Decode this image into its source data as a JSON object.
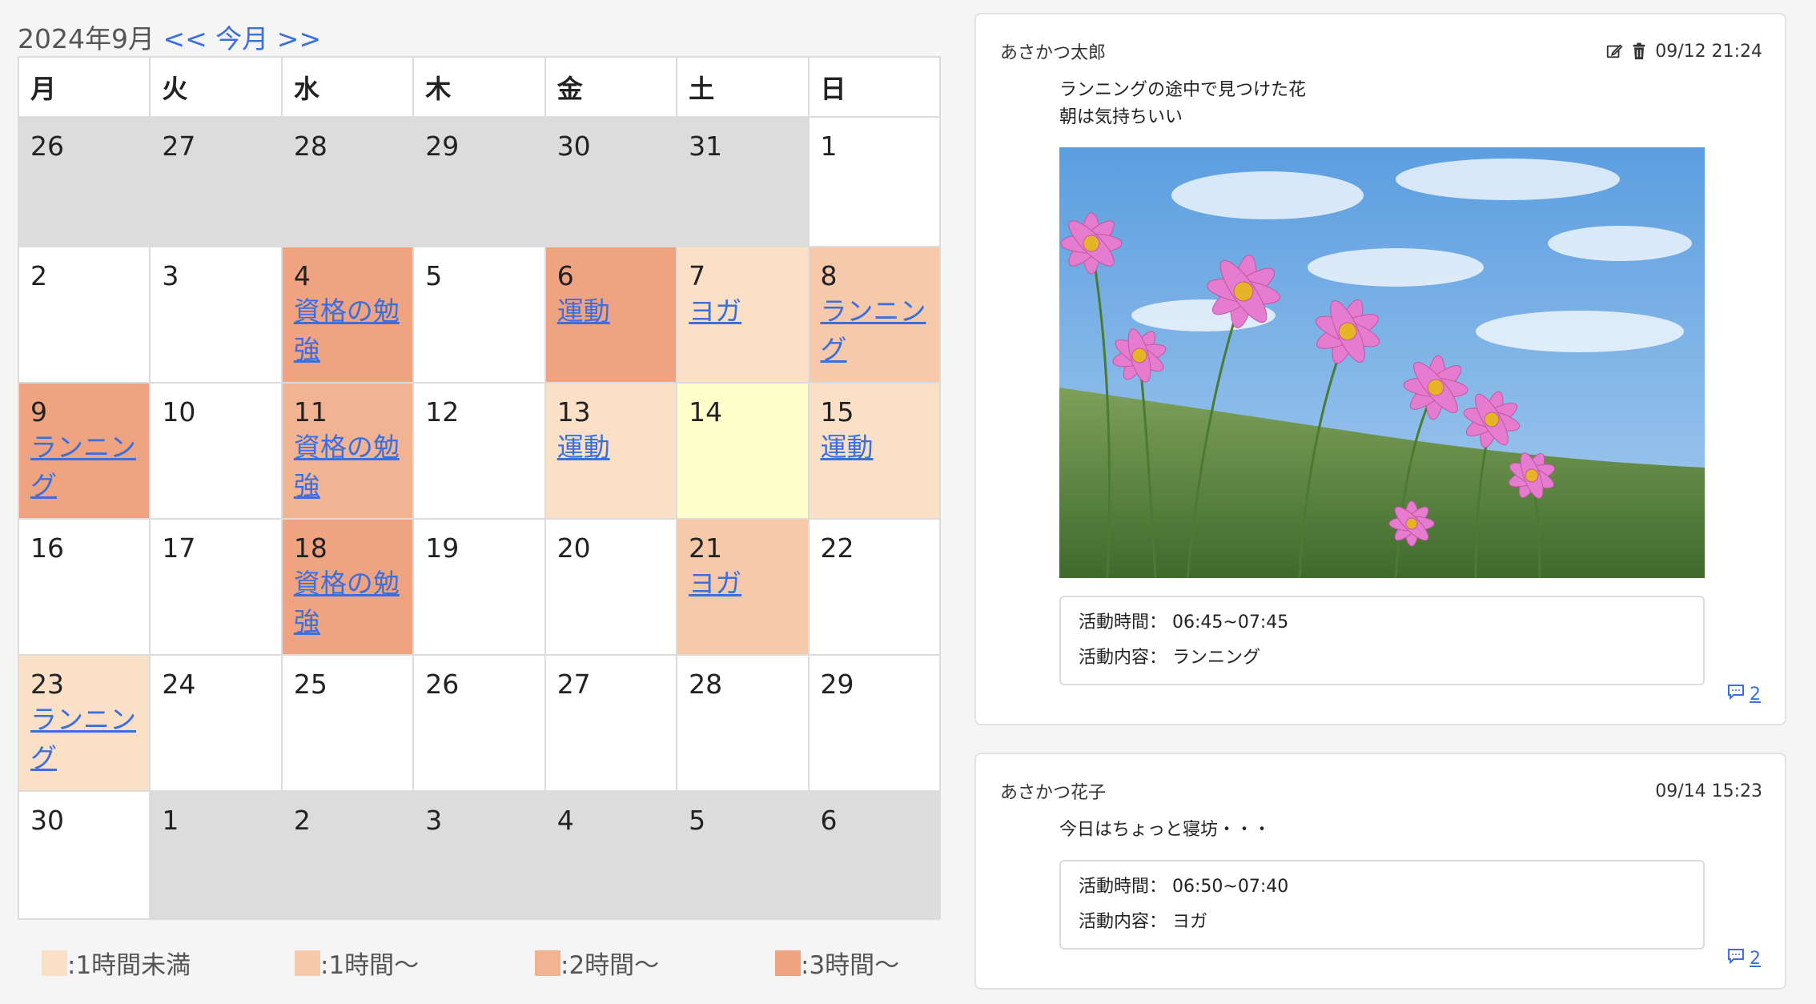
{
  "calendar": {
    "title": "2024年9月",
    "prev_label": "<<",
    "current_label": "今月",
    "next_label": ">>",
    "weekdays": [
      "月",
      "火",
      "水",
      "木",
      "金",
      "土",
      "日"
    ],
    "weeks": [
      [
        {
          "day": "26",
          "activity": ""
        },
        {
          "day": "27",
          "activity": ""
        },
        {
          "day": "28",
          "activity": ""
        },
        {
          "day": "29",
          "activity": ""
        },
        {
          "day": "30",
          "activity": ""
        },
        {
          "day": "31",
          "activity": ""
        },
        {
          "day": "1",
          "activity": ""
        }
      ],
      [
        {
          "day": "2",
          "activity": ""
        },
        {
          "day": "3",
          "activity": ""
        },
        {
          "day": "4",
          "activity": "資格の勉強"
        },
        {
          "day": "5",
          "activity": ""
        },
        {
          "day": "6",
          "activity": "運動"
        },
        {
          "day": "7",
          "activity": "ヨガ"
        },
        {
          "day": "8",
          "activity": "ランニング"
        }
      ],
      [
        {
          "day": "9",
          "activity": "ランニング"
        },
        {
          "day": "10",
          "activity": ""
        },
        {
          "day": "11",
          "activity": "資格の勉強"
        },
        {
          "day": "12",
          "activity": ""
        },
        {
          "day": "13",
          "activity": "運動"
        },
        {
          "day": "14",
          "activity": ""
        },
        {
          "day": "15",
          "activity": "運動"
        }
      ],
      [
        {
          "day": "16",
          "activity": ""
        },
        {
          "day": "17",
          "activity": ""
        },
        {
          "day": "18",
          "activity": "資格の勉強"
        },
        {
          "day": "19",
          "activity": ""
        },
        {
          "day": "20",
          "activity": ""
        },
        {
          "day": "21",
          "activity": "ヨガ"
        },
        {
          "day": "22",
          "activity": ""
        }
      ],
      [
        {
          "day": "23",
          "activity": "ランニング"
        },
        {
          "day": "24",
          "activity": ""
        },
        {
          "day": "25",
          "activity": ""
        },
        {
          "day": "26",
          "activity": ""
        },
        {
          "day": "27",
          "activity": ""
        },
        {
          "day": "28",
          "activity": ""
        },
        {
          "day": "29",
          "activity": ""
        }
      ],
      [
        {
          "day": "30",
          "activity": ""
        },
        {
          "day": "1",
          "activity": ""
        },
        {
          "day": "2",
          "activity": ""
        },
        {
          "day": "3",
          "activity": ""
        },
        {
          "day": "4",
          "activity": ""
        },
        {
          "day": "5",
          "activity": ""
        },
        {
          "day": "6",
          "activity": ""
        }
      ]
    ]
  },
  "legend": [
    {
      "label": ":1時間未満",
      "color": "#f9e0c7"
    },
    {
      "label": ":1時間〜",
      "color": "#f6c9ab"
    },
    {
      "label": ":2時間〜",
      "color": "#f2b393"
    },
    {
      "label": ":3時間〜",
      "color": "#efa380"
    }
  ],
  "posts": [
    {
      "author": "あさかつ太郎",
      "timestamp": "09/12 21:24",
      "body_line1": "ランニングの途中で見つけた花",
      "body_line2": "朝は気持ちいい",
      "time_label": "活動時間：",
      "time_value": "06:45~07:45",
      "content_label": "活動内容：",
      "content_value": "ランニング",
      "comment_count": "2",
      "icons": [
        "edit-icon",
        "trash-icon",
        "comment-icon"
      ]
    },
    {
      "author": "あさかつ花子",
      "timestamp": "09/14 15:23",
      "body_line1": "今日はちょっと寝坊・・・",
      "time_label": "活動時間：",
      "time_value": "06:50~07:40",
      "content_label": "活動内容：",
      "content_value": "ヨガ",
      "comment_count": "2",
      "icons": [
        "comment-icon"
      ]
    }
  ]
}
